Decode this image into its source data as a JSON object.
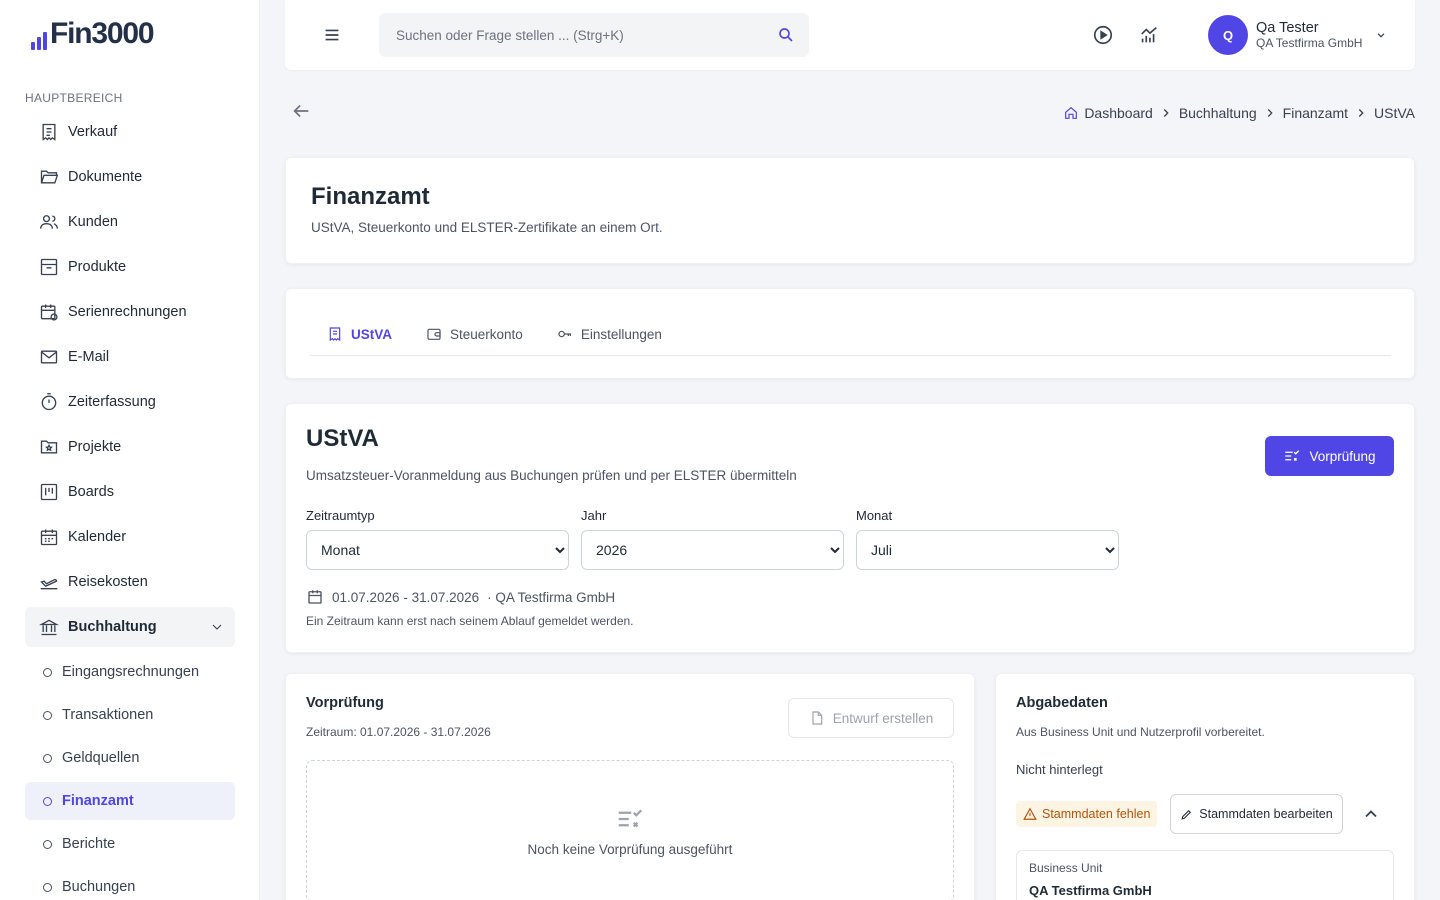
{
  "app": {
    "logo_text": "Fin3000"
  },
  "sidebar": {
    "section_title": "HAUPTBEREICH",
    "items": [
      {
        "label": "Verkauf",
        "icon": "receipt-icon"
      },
      {
        "label": "Dokumente",
        "icon": "folder-open-icon"
      },
      {
        "label": "Kunden",
        "icon": "users-icon"
      },
      {
        "label": "Produkte",
        "icon": "archive-box-icon"
      },
      {
        "label": "Serienrechnungen",
        "icon": "calendar-repeat-icon"
      },
      {
        "label": "E-Mail",
        "icon": "mail-icon"
      },
      {
        "label": "Zeiterfassung",
        "icon": "stopwatch-icon"
      },
      {
        "label": "Projekte",
        "icon": "folder-star-icon"
      },
      {
        "label": "Boards",
        "icon": "kanban-icon"
      },
      {
        "label": "Kalender",
        "icon": "calendar-icon"
      },
      {
        "label": "Reisekosten",
        "icon": "plane-icon"
      }
    ],
    "open_group": {
      "label": "Buchhaltung",
      "icon": "bank-icon"
    },
    "sub_items": [
      {
        "label": "Eingangsrechnungen"
      },
      {
        "label": "Transaktionen"
      },
      {
        "label": "Geldquellen"
      },
      {
        "label": "Finanzamt",
        "active": true
      },
      {
        "label": "Berichte"
      },
      {
        "label": "Buchungen"
      }
    ]
  },
  "header": {
    "search_placeholder": "Suchen oder Frage stellen ... (Strg+K)",
    "user": {
      "initial": "Q",
      "name": "Qa Tester",
      "org": "QA Testfirma GmbH"
    }
  },
  "breadcrumb": [
    "Dashboard",
    "Buchhaltung",
    "Finanzamt",
    "UStVA"
  ],
  "page": {
    "title": "Finanzamt",
    "subtitle": "UStVA, Steuerkonto und ELSTER-Zertifikate an einem Ort."
  },
  "tabs": [
    {
      "label": "UStVA",
      "icon": "receipt-icon",
      "active": true
    },
    {
      "label": "Steuerkonto",
      "icon": "wallet-icon",
      "active": false
    },
    {
      "label": "Einstellungen",
      "icon": "key-icon",
      "active": false
    }
  ],
  "ustva": {
    "title": "UStVA",
    "subtitle": "Umsatzsteuer-Voranmeldung aus Buchungen prüfen und per ELSTER übermitteln",
    "button": "Vorprüfung",
    "fields": {
      "zeitraumtyp": {
        "label": "Zeitraumtyp",
        "value": "Monat"
      },
      "jahr": {
        "label": "Jahr",
        "value": "2026"
      },
      "monat": {
        "label": "Monat",
        "value": "Juli"
      }
    },
    "period": "01.07.2026 - 31.07.2026",
    "period_company": "· QA Testfirma GmbH",
    "note": "Ein Zeitraum kann erst nach seinem Ablauf gemeldet werden."
  },
  "vorpruefung": {
    "title": "Vorprüfung",
    "subtitle": "Zeitraum: 01.07.2026 - 31.07.2026",
    "button": "Entwurf erstellen",
    "empty_text": "Noch keine Vorprüfung ausgeführt"
  },
  "abgabedaten": {
    "title": "Abgabedaten",
    "subtitle": "Aus Business Unit und Nutzerprofil vorbereitet.",
    "state": "Nicht hinterlegt",
    "warning": "Stammdaten fehlen",
    "edit_button": "Stammdaten bearbeiten",
    "bu_label": "Business Unit",
    "bu_value": "QA Testfirma GmbH"
  },
  "colors": {
    "accent": "#5046e5",
    "warning_bg": "#fdf4e4",
    "warning_text": "#b45309"
  }
}
